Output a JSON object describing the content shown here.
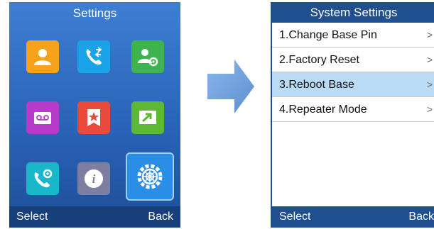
{
  "left_screen": {
    "title": "Settings",
    "apps": [
      {
        "icon": "contacts-icon",
        "color": "#f7a21b"
      },
      {
        "icon": "call-history-icon",
        "color": "#1aa3e8"
      },
      {
        "icon": "contact-settings-icon",
        "color": "#3fb34f"
      },
      {
        "icon": "voicemail-icon",
        "color": "#b83ac9"
      },
      {
        "icon": "favorites-icon",
        "color": "#e94a3c"
      },
      {
        "icon": "messages-icon",
        "color": "#5db931"
      },
      {
        "icon": "call-settings-icon",
        "color": "#19b7c9"
      },
      {
        "icon": "info-icon",
        "color": "#7c7fa1"
      },
      {
        "icon": "settings-gear-icon",
        "color": "#2a8de6"
      }
    ],
    "softkeys": {
      "left": "Select",
      "right": "Back"
    }
  },
  "arrow": {
    "icon": "arrow-right-icon",
    "color": "#6ea0dc"
  },
  "right_screen": {
    "title": "System Settings",
    "items": [
      {
        "label": "1.Change Base Pin",
        "chevron": ">",
        "selected": false
      },
      {
        "label": "2.Factory Reset",
        "chevron": ">",
        "selected": false
      },
      {
        "label": "3.Reboot Base",
        "chevron": ">",
        "selected": true
      },
      {
        "label": "4.Repeater Mode",
        "chevron": ">",
        "selected": false
      }
    ],
    "softkeys": {
      "left": "Select",
      "right": "Back"
    },
    "colors": {
      "header": "#1f4f8f",
      "selected": "#b9dbf5"
    }
  }
}
